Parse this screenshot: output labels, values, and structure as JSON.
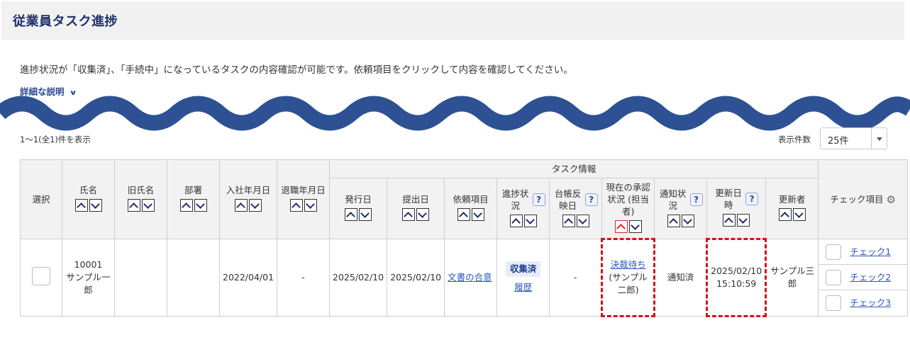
{
  "page": {
    "title": "従業員タスク進捗",
    "description": "進捗状況が「収集済」、「手続中」になっているタスクの内容確認が可能です。依頼項目をクリックして内容を確認してください。",
    "detail_link": "詳細な説明",
    "count_text": "1〜1(全1)件を表示",
    "per_page_label": "表示件数",
    "per_page_value": "25件"
  },
  "table": {
    "group_header": "タスク情報",
    "columns": {
      "select": "選択",
      "name": "氏名",
      "old_name": "旧氏名",
      "dept": "部署",
      "join_date": "入社年月日",
      "leave_date": "退職年月日",
      "issue_date": "発行日",
      "submit_date": "提出日",
      "request_item": "依頼項目",
      "progress": "進捗状況",
      "ledger_date": "台帳反映日",
      "approval": "現在の承認状況 (担当者)",
      "notify": "通知状況",
      "updated_at": "更新日時",
      "updater": "更新者",
      "check_items": "チェック項目"
    },
    "help_mark": "?",
    "row": {
      "employee_no": "10001",
      "name": "サンプル一郎",
      "old_name": "",
      "dept": "",
      "join_date": "2022/04/01",
      "leave_date": "-",
      "issue_date": "2025/02/10",
      "submit_date": "2025/02/10",
      "request_item": "文書の合意",
      "progress": "収集済",
      "history": "履歴",
      "ledger_date": "-",
      "approval_status": "決裁待ち",
      "approver": "(サンプル　二郎)",
      "notify": "通知済",
      "updated_at": "2025/02/10 15:10:59",
      "updater": "サンプル三郎",
      "checks": [
        "チェック1",
        "チェック2",
        "チェック3"
      ]
    }
  },
  "colors": {
    "title": "#1e2f6b",
    "wave": "#2d5193",
    "link": "#2b59b7",
    "highlight_border": "#d4121a",
    "header_bg": "#f2f2f2"
  },
  "icons": {
    "detail_chevron": "chevron-down-icon",
    "settings": "gear-icon",
    "sort_up": "chevron-up-icon",
    "sort_down": "chevron-down-icon"
  }
}
